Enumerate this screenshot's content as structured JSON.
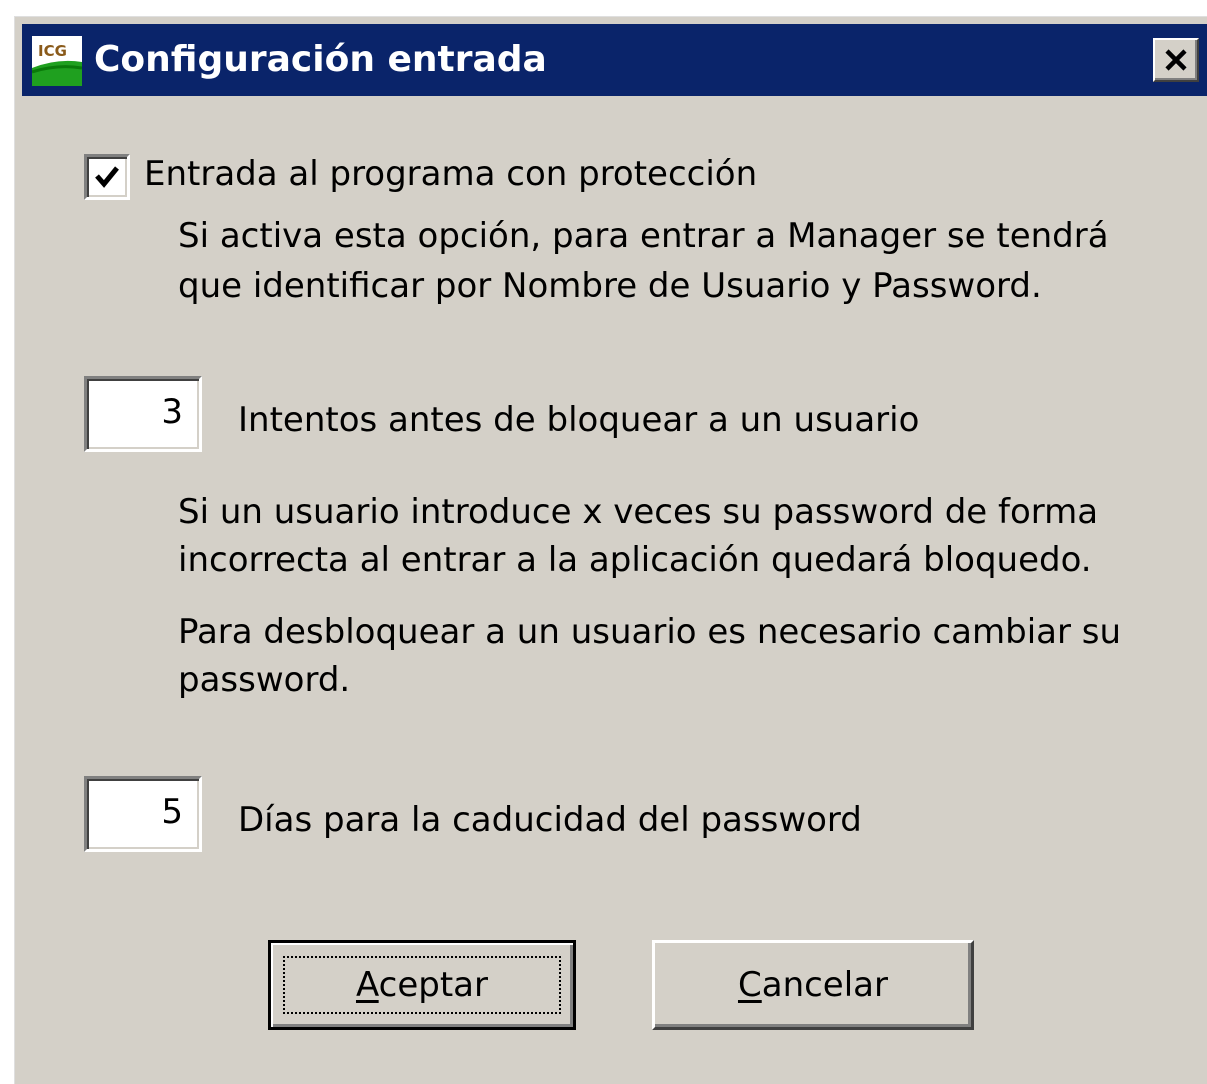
{
  "window": {
    "title": "Configuración entrada",
    "icon": "app-logo-icon",
    "close_icon": "close-x-icon"
  },
  "protection": {
    "checkbox_checked": true,
    "label": "Entrada al programa con protección",
    "description_line1": "Si activa esta opción, para entrar a Manager se tendrá",
    "description_line2": "que identificar por Nombre de Usuario y Password."
  },
  "attempts": {
    "value": "3",
    "label": "Intentos antes de bloquear a un usuario",
    "description_line1": "Si un usuario introduce x veces su password de forma",
    "description_line2": "incorrecta al entrar a la aplicación quedará bloquedo.",
    "description_line3": "Para desbloquear a un usuario es necesario cambiar su",
    "description_line4": "password."
  },
  "expiry": {
    "value": "5",
    "label": "Días para la caducidad del password"
  },
  "buttons": {
    "accept_mnemonic": "A",
    "accept_rest": "ceptar",
    "cancel_mnemonic": "C",
    "cancel_rest": "ancelar"
  },
  "colors": {
    "titlebar": "#0a246a",
    "face": "#d4d0c8"
  }
}
